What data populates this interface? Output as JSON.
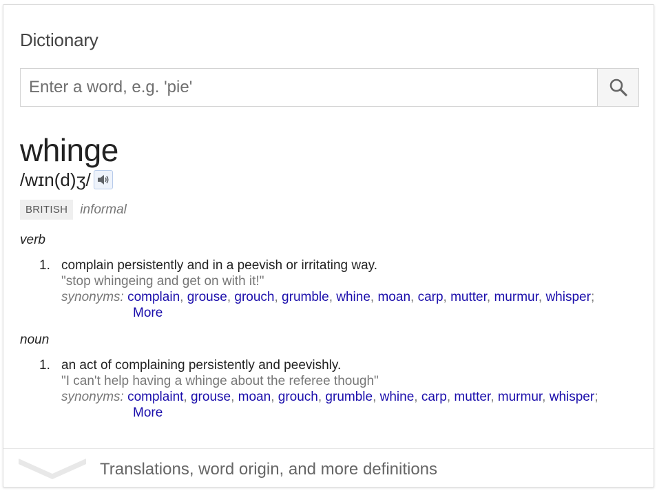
{
  "header": {
    "title": "Dictionary"
  },
  "search": {
    "placeholder": "Enter a word, e.g. 'pie'",
    "value": "",
    "button_icon": "search-icon"
  },
  "entry": {
    "word": "whinge",
    "pronunciation": "/wɪn(d)ʒ/",
    "audio_icon": "speaker-icon",
    "region_badge": "BRITISH",
    "register": "informal",
    "senses": [
      {
        "pos": "verb",
        "number": "1.",
        "definition": "complain persistently and in a peevish or irritating way.",
        "example": "\"stop whingeing and get on with it!\"",
        "synonyms_label": "synonyms:",
        "synonyms": [
          "complain",
          "grouse",
          "grouch",
          "grumble",
          "whine",
          "moan",
          "carp",
          "mutter",
          "murmur",
          "whisper"
        ],
        "more_label": "More"
      },
      {
        "pos": "noun",
        "number": "1.",
        "definition": "an act of complaining persistently and peevishly.",
        "example": "\"I can't help having a whinge about the referee though\"",
        "synonyms_label": "synonyms:",
        "synonyms": [
          "complaint",
          "grouse",
          "moan",
          "grouch",
          "grumble",
          "whine",
          "carp",
          "mutter",
          "murmur",
          "whisper"
        ],
        "more_label": "More"
      }
    ]
  },
  "footer": {
    "label": "Translations, word origin, and more definitions",
    "icon": "chevron-down-icon"
  },
  "colors": {
    "link": "#1a0dab",
    "muted": "#777777",
    "text": "#222222"
  }
}
